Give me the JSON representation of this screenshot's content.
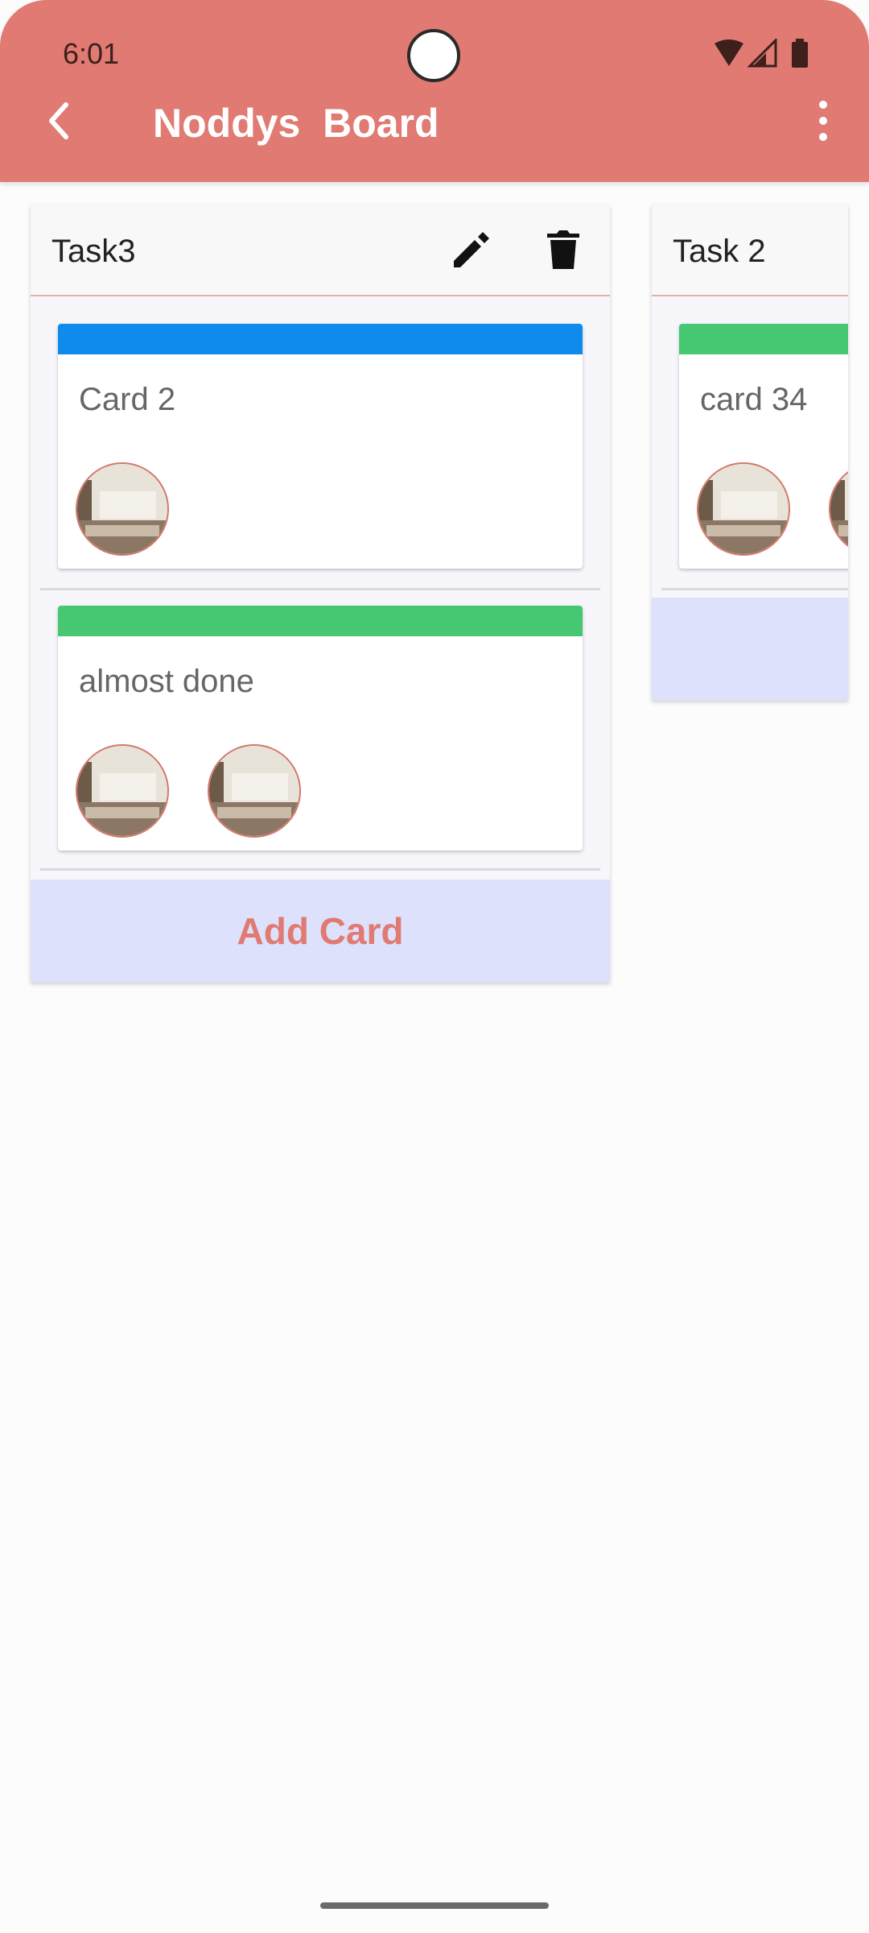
{
  "status_bar": {
    "time": "6:01",
    "icons": [
      "wifi-icon",
      "signal-icon",
      "battery-icon"
    ]
  },
  "app_bar": {
    "title": "Noddys  Board",
    "back_icon": "chevron-left-icon",
    "menu_icon": "more-vertical-icon"
  },
  "colors": {
    "accent": "#e07a72",
    "label_blue": "#0e8bec",
    "label_green": "#45c871",
    "add_card_bg": "#dde1fb"
  },
  "lists": [
    {
      "title": "Task3",
      "actions": [
        "edit-icon",
        "delete-icon"
      ],
      "cards": [
        {
          "title": "Card 2",
          "label_color": "#0e8bec",
          "members": 1
        },
        {
          "title": "almost done",
          "label_color": "#45c871",
          "members": 2
        }
      ],
      "add_card_label": "Add Card"
    },
    {
      "title": "Task 2",
      "cards": [
        {
          "title": "card 34",
          "label_color": "#45c871",
          "members": 2
        }
      ]
    }
  ]
}
